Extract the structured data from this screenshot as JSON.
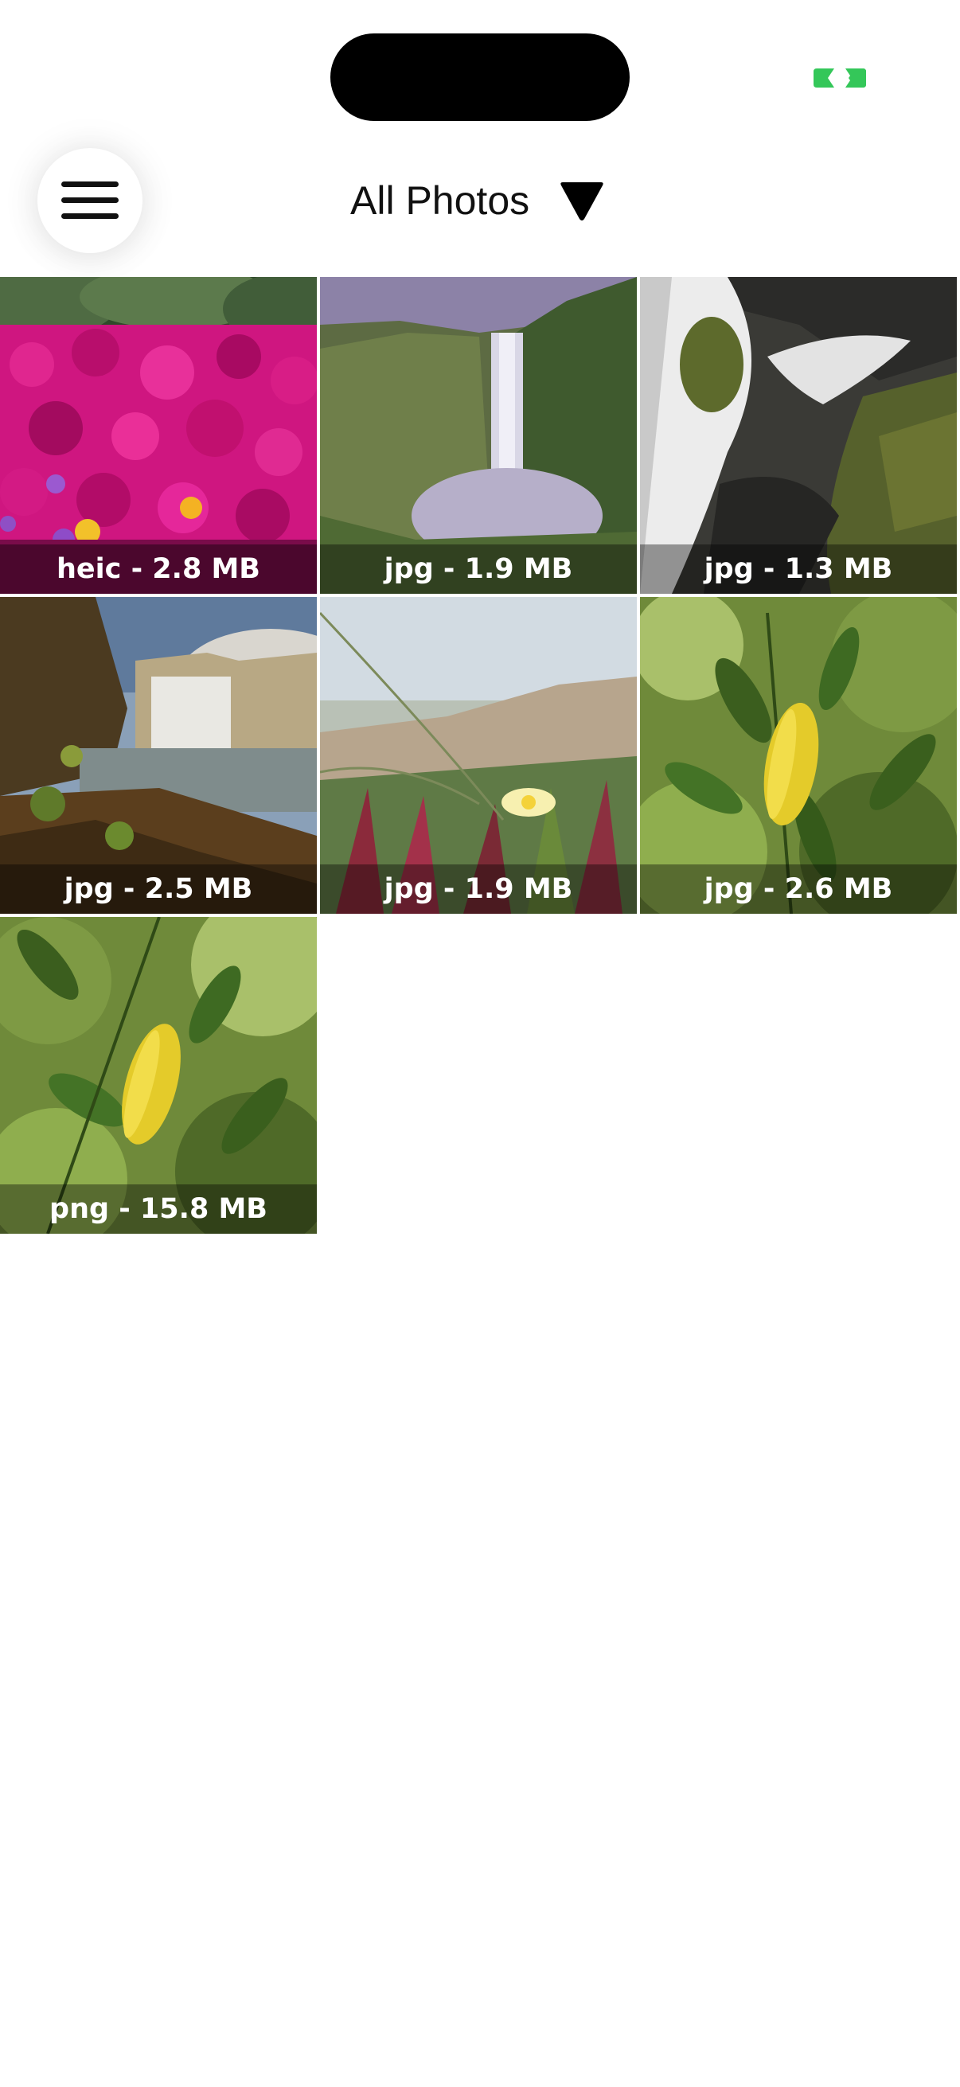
{
  "status_bar": {
    "indicator_color": "#34c759",
    "indicator_icon": "link-indicator"
  },
  "header": {
    "menu_icon": "hamburger-menu",
    "album_title": "All Photos",
    "dropdown_icon": "triangle-down"
  },
  "photos": [
    {
      "caption": "heic - 2.8 MB",
      "subject": "flowers"
    },
    {
      "caption": "jpg - 1.9 MB",
      "subject": "waterfall-cliff"
    },
    {
      "caption": "jpg - 1.3 MB",
      "subject": "waterfall-rocks"
    },
    {
      "caption": "jpg - 2.5 MB",
      "subject": "waterfall-shore"
    },
    {
      "caption": "jpg - 1.9 MB",
      "subject": "flower-dunes"
    },
    {
      "caption": "jpg - 2.6 MB",
      "subject": "yellow-leaf"
    },
    {
      "caption": "png - 15.8 MB",
      "subject": "yellow-leaf"
    }
  ]
}
